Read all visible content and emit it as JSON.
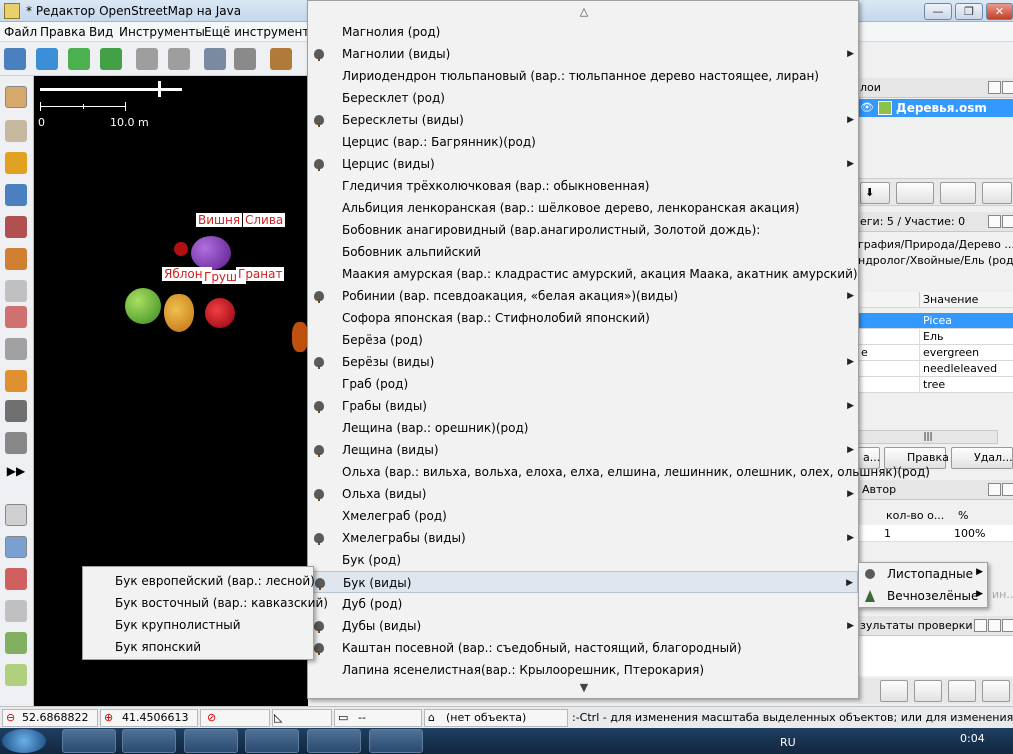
{
  "window": {
    "title": "* Редактор OpenStreetMap на Java",
    "buttons": {
      "minimize": "—",
      "maximize": "❐",
      "close": "✕"
    }
  },
  "menubar": [
    "Файл",
    "Правка",
    "Вид",
    "Инструменты",
    "Ещё инструменты"
  ],
  "map": {
    "scale_start": "0",
    "scale_end": "10.0 m",
    "fruit_labels": [
      "Вишня",
      "Слива",
      "Яблоня",
      "Груша",
      "Гранат"
    ]
  },
  "dropdown": {
    "scroll_up": "△",
    "scroll_down": "▼",
    "items": [
      {
        "label": "Магнолия (род)",
        "icon": "",
        "submenu": ""
      },
      {
        "label": "Магнолии (виды)",
        "icon": "magnolia-icon",
        "submenu": "▶"
      },
      {
        "label": "Лириодендрон тюльпановый (вар.: тюльпанное дерево настоящее, лиран)",
        "icon": "",
        "submenu": ""
      },
      {
        "label": "Бересклет (род)",
        "icon": "",
        "submenu": ""
      },
      {
        "label": "Бересклеты (виды)",
        "icon": "tree-icon",
        "submenu": "▶"
      },
      {
        "label": "Церцис (вар.: Багрянник)(род)",
        "icon": "",
        "submenu": ""
      },
      {
        "label": "Церцис (виды)",
        "icon": "tree-icon",
        "submenu": "▶"
      },
      {
        "label": "Гледичия трёхколючковая (вар.: обыкновенная)",
        "icon": "",
        "submenu": ""
      },
      {
        "label": "Альбиция ленкоранская (вар.: шёлковое дерево, ленкоранская акация)",
        "icon": "",
        "submenu": ""
      },
      {
        "label": "Бобовник анагировидный (вар.анагиролистный, Золотой дождь):",
        "icon": "",
        "submenu": ""
      },
      {
        "label": "Бобовник альпийский",
        "icon": "",
        "submenu": ""
      },
      {
        "label": "Маакия амурская (вар.: кладрастис амурский, акация Маака, акатник амурский)",
        "icon": "",
        "submenu": ""
      },
      {
        "label": "Робинии (вар. псевдоакация, «белая акация»)(виды)",
        "icon": "tree-icon",
        "submenu": "▶"
      },
      {
        "label": "Софора японская (вар.: Стифнолобий японский)",
        "icon": "",
        "submenu": ""
      },
      {
        "label": "Берёза (род)",
        "icon": "",
        "submenu": ""
      },
      {
        "label": "Берёзы (виды)",
        "icon": "birch-icon",
        "submenu": "▶"
      },
      {
        "label": "Граб (род)",
        "icon": "",
        "submenu": ""
      },
      {
        "label": "Грабы (виды)",
        "icon": "tree-icon",
        "submenu": "▶"
      },
      {
        "label": "Лещина (вар.: орешник)(род)",
        "icon": "",
        "submenu": ""
      },
      {
        "label": "Лещина (виды)",
        "icon": "tree-icon",
        "submenu": "▶"
      },
      {
        "label": "Ольха (вар.: вильха, вольха, елоха, елха, елшина, лешинник, олешник, олех, ольшняк)(род)",
        "icon": "",
        "submenu": ""
      },
      {
        "label": "Ольха (виды)",
        "icon": "tree-icon",
        "submenu": "▶"
      },
      {
        "label": "Хмелеграб (род)",
        "icon": "",
        "submenu": ""
      },
      {
        "label": "Хмелеграбы (виды)",
        "icon": "tree-icon",
        "submenu": "▶"
      },
      {
        "label": "Бук (род)",
        "icon": "",
        "submenu": ""
      },
      {
        "label": "Бук (виды)",
        "icon": "tree-icon",
        "submenu": "▶",
        "highlighted": true
      },
      {
        "label": "Дуб (род)",
        "icon": "",
        "submenu": ""
      },
      {
        "label": "Дубы (виды)",
        "icon": "oak-icon",
        "submenu": "▶"
      },
      {
        "label": "Каштан посевной (вар.: съедобный, настоящий, благородный)",
        "icon": "chestnut-icon",
        "submenu": ""
      },
      {
        "label": "Лапина ясенелистная(вар.: Крылоорешник, Птерокария)",
        "icon": "",
        "submenu": ""
      }
    ]
  },
  "left_submenu": [
    "Бук европейский (вар.: лесной)",
    "Бук восточный (вар.: кавказский)",
    "Бук крупнолистный",
    "Бук японский"
  ],
  "right_submenu": [
    {
      "label": "Листопадные",
      "submenu": "▶"
    },
    {
      "label": "Вечнозелёные",
      "submenu": "▶"
    }
  ],
  "right_panel": {
    "layers_header": "лои",
    "layer_name": "Деревья.osm",
    "tags_header": "еги: 5 / Участие: 0",
    "presets": [
      "графия/Природа/Дерево ...",
      "ндролог/Хвойные/Ель (род)"
    ],
    "value_col_header": "Значение",
    "tag_rows": [
      {
        "key": "",
        "value": "Picea",
        "selected": true
      },
      {
        "key": "",
        "value": "Ель"
      },
      {
        "key": "е",
        "value": "evergreen"
      },
      {
        "key": "",
        "value": "needleleaved"
      },
      {
        "key": "",
        "value": "tree"
      }
    ],
    "scroll_dots": "|||",
    "btn_edit_left": "а...",
    "btn_edit": "Правка",
    "btn_delete": "Удал...",
    "author_header": "Автор",
    "author_cols": [
      "кол-во о...",
      "%"
    ],
    "author_row": [
      "1",
      "100%"
    ],
    "faded_text": "ин...",
    "validation_header": "зультаты проверки"
  },
  "statusbar": {
    "lat": "52.6868822",
    "lon": "41.4506613",
    "dist": "--",
    "object": "(нет объекта)",
    "hint": ":-Ctrl - для изменения масштаба выделенных объектов; или для изменения выделения"
  },
  "taskbar": {
    "lang": "RU",
    "time": "0:04"
  },
  "colors": {
    "selection": "#3399ff",
    "highlight": "#e0e6ef",
    "fruit_label": "#d32020"
  }
}
